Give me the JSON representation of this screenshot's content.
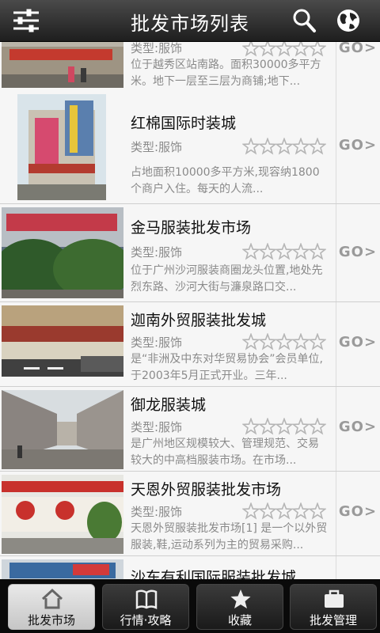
{
  "header": {
    "title": "批发市场列表",
    "menu_icon": "sliders-icon",
    "search_icon": "search-icon",
    "globe_icon": "globe-icon"
  },
  "markets": [
    {
      "name": "",
      "type": "类型:服饰",
      "rating": 0,
      "desc": "位于越秀区站南路。面积30000多平方米。地下一层至三层为商铺;地下...",
      "go": "GO>"
    },
    {
      "name": "红棉国际时装城",
      "type": "类型:服饰",
      "rating": 0,
      "desc": "占地面积10000多平方米,现容纳1800个商户入住。每天的人流...",
      "go": "GO>"
    },
    {
      "name": "金马服装批发市场",
      "type": "类型:服饰",
      "rating": 0,
      "desc": "位于广州沙河服装商圈龙头位置,地处先烈东路、沙河大街与濂泉路口交...",
      "go": "GO>"
    },
    {
      "name": "迦南外贸服装批发城",
      "type": "类型:服饰",
      "rating": 0,
      "desc": "是“非洲及中东对华贸易协会”会员单位,于2003年5月正式开业。三年...",
      "go": "GO>"
    },
    {
      "name": "御龙服装城",
      "type": "类型:服饰",
      "rating": 0,
      "desc": "是广州地区规模较大、管理规范、交易较大的中高档服装市场。在市场...",
      "go": "GO>"
    },
    {
      "name": "天恩外贸服装批发市场",
      "type": "类型:服饰",
      "rating": 0,
      "desc": "天恩外贸服装批发市场[1] 是一个以外贸服装,鞋,运动系列为主的贸易采购...",
      "go": "GO>"
    },
    {
      "name": "沙东有利国际服装批发城",
      "type": "",
      "rating": 0,
      "desc": "",
      "go": ""
    }
  ],
  "tabs": [
    {
      "label": "批发市场",
      "icon": "home-icon",
      "active": true
    },
    {
      "label": "行情·攻略",
      "icon": "book-icon",
      "active": false
    },
    {
      "label": "收藏",
      "icon": "star-icon",
      "active": false
    },
    {
      "label": "批发管理",
      "icon": "briefcase-icon",
      "active": false
    }
  ],
  "colors": {
    "topbar": "#2a2a2a",
    "tabbar": "#0a0a0a",
    "active_tab": "#d8d8d8",
    "secondary_text": "#8a8a8a"
  }
}
